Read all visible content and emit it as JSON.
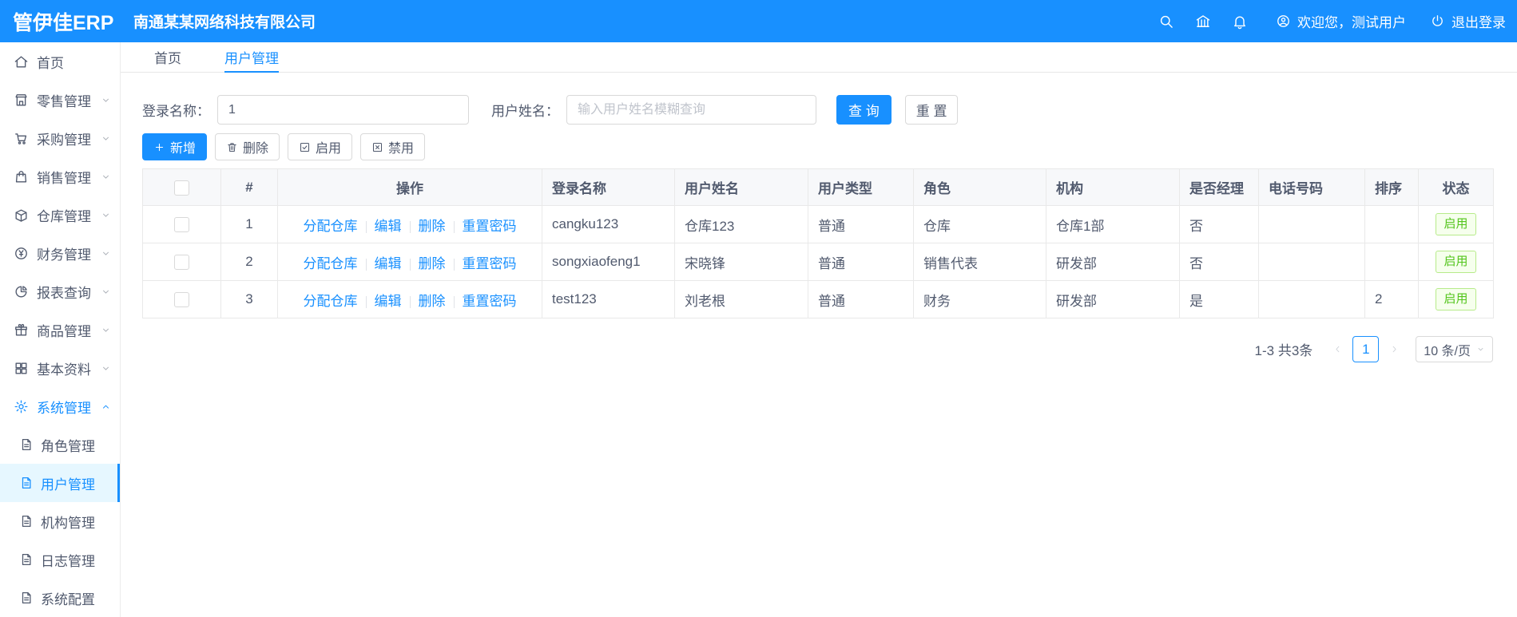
{
  "header": {
    "logo": "管伊佳ERP",
    "company": "南通某某网络科技有限公司",
    "welcome": "欢迎您，测试用户",
    "logout": "退出登录",
    "icons": [
      "search-icon",
      "bank-icon",
      "bell-icon",
      "user-circle-icon",
      "power-icon"
    ]
  },
  "sidebar": {
    "items": [
      {
        "label": "首页",
        "icon": "home-icon",
        "expandable": false
      },
      {
        "label": "零售管理",
        "icon": "retail-icon",
        "expandable": true
      },
      {
        "label": "采购管理",
        "icon": "purchase-icon",
        "expandable": true
      },
      {
        "label": "销售管理",
        "icon": "sales-icon",
        "expandable": true
      },
      {
        "label": "仓库管理",
        "icon": "warehouse-icon",
        "expandable": true
      },
      {
        "label": "财务管理",
        "icon": "finance-icon",
        "expandable": true
      },
      {
        "label": "报表查询",
        "icon": "report-icon",
        "expandable": true
      },
      {
        "label": "商品管理",
        "icon": "goods-icon",
        "expandable": true
      },
      {
        "label": "基本资料",
        "icon": "basedata-icon",
        "expandable": true
      },
      {
        "label": "系统管理",
        "icon": "gear-icon",
        "expandable": true,
        "expanded": true
      }
    ],
    "system_submenu": [
      {
        "label": "角色管理",
        "icon": "doc-icon"
      },
      {
        "label": "用户管理",
        "icon": "doc-icon",
        "selected": true
      },
      {
        "label": "机构管理",
        "icon": "doc-icon"
      },
      {
        "label": "日志管理",
        "icon": "doc-icon"
      },
      {
        "label": "系统配置",
        "icon": "doc-icon"
      }
    ]
  },
  "tabs": [
    {
      "label": "首页",
      "active": false
    },
    {
      "label": "用户管理",
      "active": true
    }
  ],
  "filters": {
    "login_name_label": "登录名称：",
    "login_name_value": "1",
    "user_name_label": "用户姓名：",
    "user_name_placeholder": "输入用户姓名模糊查询",
    "search_button": "查 询",
    "reset_button": "重 置"
  },
  "toolbar": {
    "add_button": "新增",
    "delete_button": "删除",
    "enable_button": "启用",
    "disable_button": "禁用"
  },
  "table": {
    "headers": [
      "#",
      "操作",
      "登录名称",
      "用户姓名",
      "用户类型",
      "角色",
      "机构",
      "是否经理",
      "电话号码",
      "排序",
      "状态"
    ],
    "row_actions": [
      "分配仓库",
      "编辑",
      "删除",
      "重置密码"
    ],
    "rows": [
      {
        "num": "1",
        "login_name": "cangku123",
        "user_name": "仓库123",
        "user_type": "普通",
        "role": "仓库",
        "org": "仓库1部",
        "is_manager": "否",
        "phone": "",
        "sort": "",
        "status": "启用"
      },
      {
        "num": "2",
        "login_name": "songxiaofeng1",
        "user_name": "宋晓锋",
        "user_type": "普通",
        "role": "销售代表",
        "org": "研发部",
        "is_manager": "否",
        "phone": "",
        "sort": "",
        "status": "启用"
      },
      {
        "num": "3",
        "login_name": "test123",
        "user_name": "刘老根",
        "user_type": "普通",
        "role": "财务",
        "org": "研发部",
        "is_manager": "是",
        "phone": "",
        "sort": "2",
        "status": "启用"
      }
    ]
  },
  "pagination": {
    "total_text": "1-3 共3条",
    "current_page": "1",
    "page_size": "10 条/页"
  },
  "colors": {
    "primary": "#1890ff",
    "header_bg": "#1890ff",
    "selected_menu_bg": "#e6f7ff",
    "status_enabled_text": "#52c41a",
    "status_enabled_bg": "#f6ffed",
    "status_enabled_border": "#b7eb8a",
    "table_border": "#e9e9e9",
    "table_header_bg": "#f7f8fa"
  }
}
